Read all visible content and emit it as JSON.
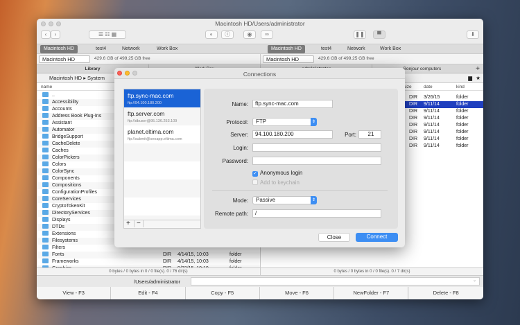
{
  "window": {
    "title": "Macintosh HD/Users/administrator"
  },
  "toolbar": {
    "back": "‹",
    "forward": "›"
  },
  "left": {
    "tabs": [
      "Macintosh HD",
      "test4",
      "Network",
      "Work Box"
    ],
    "drive": "Macintosh HD",
    "free": "429.6 GB of 499.25 GB free",
    "pane_tabs": [
      "Library",
      "Work Box"
    ],
    "path": [
      "Macintosh HD",
      "System"
    ],
    "columns": {
      "name": "name"
    },
    "files": [
      "..",
      "Accessibility",
      "Accounts",
      "Address Book Plug-Ins",
      "Assistant",
      "Automator",
      "BridgeSupport",
      "CacheDelete",
      "Caches",
      "ColorPickers",
      "Colors",
      "ColorSync",
      "Components",
      "Compositions",
      "ConfigurationProfiles",
      "CoreServices",
      "CryptoTokenKit",
      "DirectoryServices",
      "Displays",
      "DTDs",
      "Extensions",
      "Filesystems",
      "Filters",
      "Fonts",
      "Frameworks",
      "Graphics"
    ],
    "visible_details": [
      {
        "size": "DIR",
        "date": "4/14/15, 10:03",
        "kind": "folder"
      },
      {
        "size": "DIR",
        "date": "4/14/15, 10:03",
        "kind": "folder"
      },
      {
        "size": "DIR",
        "date": "9/22/15, 10:10",
        "kind": "folder"
      }
    ],
    "status": "0 bytes / 0 bytes in 0 / 0 file(s). 0 / 76 dir(s)"
  },
  "right": {
    "tabs": [
      "Macintosh HD",
      "test4",
      "Network",
      "Work Box"
    ],
    "drive": "Macintosh HD",
    "free": "429.6 GB of 499.25 GB free",
    "pane_tabs": [
      "administrator",
      "Bonjour computers"
    ],
    "columns": {
      "size": "size",
      "date": "date",
      "kind": "kind"
    },
    "rows": [
      {
        "size": "DIR",
        "date": "3/26/15",
        "kind": "folder"
      },
      {
        "size": "DIR",
        "date": "9/11/14",
        "kind": "folder",
        "selected": true
      },
      {
        "size": "DIR",
        "date": "9/11/14",
        "kind": "folder"
      },
      {
        "size": "DIR",
        "date": "9/11/14",
        "kind": "folder"
      },
      {
        "size": "DIR",
        "date": "9/11/14",
        "kind": "folder"
      },
      {
        "size": "DIR",
        "date": "9/11/14",
        "kind": "folder"
      },
      {
        "size": "DIR",
        "date": "9/11/14",
        "kind": "folder"
      },
      {
        "size": "DIR",
        "date": "9/11/14",
        "kind": "folder"
      }
    ],
    "status": "0 bytes / 0 bytes in 0 / 0 file(s). 0 / 7 dir(s)"
  },
  "command": {
    "path": "/Users/administrator",
    "value": ""
  },
  "fkeys": [
    "View - F3",
    "Edit - F4",
    "Copy - F5",
    "Move - F6",
    "NewFolder - F7",
    "Delete - F8"
  ],
  "dialog": {
    "title": "Connections",
    "connections": [
      {
        "name": "ftp.sync-mac.com",
        "url": "ftp://94.100.180.200"
      },
      {
        "name": "ftp.server.com",
        "url": "ftp://dbuser@95.136.253.109"
      },
      {
        "name": "planet.eltima.com",
        "url": "ftp://submit@seoapp.eltima.com"
      }
    ],
    "labels": {
      "name": "Name:",
      "protocol": "Protocol:",
      "server": "Server:",
      "port": "Port:",
      "login": "Login:",
      "password": "Password:",
      "mode": "Mode:",
      "remote": "Remote path:"
    },
    "values": {
      "name": "ftp.sync-mac.com",
      "protocol": "FTP",
      "server": "94.100.180.200",
      "port": "21",
      "login": "",
      "password": "",
      "mode": "Passive",
      "remote": "/"
    },
    "anonymous": {
      "label": "Anonymous login",
      "checked": true
    },
    "keychain": {
      "label": "Add to keychain",
      "checked": false,
      "enabled": false
    },
    "add": "+",
    "remove": "−",
    "close": "Close",
    "connect": "Connect"
  },
  "colors": {
    "accent": "#1a63d6",
    "selection": "#1f3fbf",
    "button": "#3d8ef3"
  }
}
